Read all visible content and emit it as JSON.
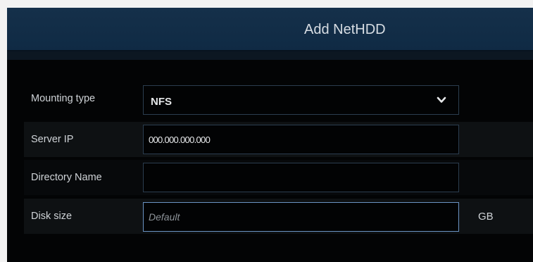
{
  "dialog": {
    "title": "Add NetHDD"
  },
  "form": {
    "mounting_type": {
      "label": "Mounting type",
      "value": "NFS"
    },
    "server_ip": {
      "label": "Server IP",
      "value": "000.000.000.000"
    },
    "directory_name": {
      "label": "Directory Name",
      "value": ""
    },
    "disk_size": {
      "label": "Disk size",
      "placeholder": "Default",
      "unit": "GB"
    }
  },
  "icons": {
    "select_arrow": "chevron-down-icon"
  },
  "colors": {
    "title_bar": "#112c47",
    "background": "#030405",
    "focused_border": "#6a93c3",
    "field_border": "#2b3d4f"
  }
}
